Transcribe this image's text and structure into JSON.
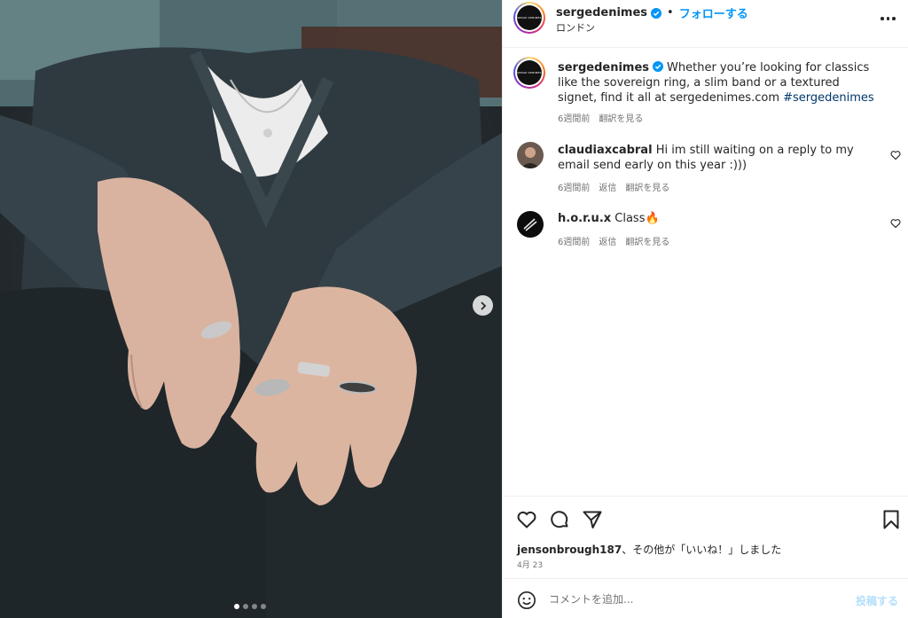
{
  "post": {
    "username": "sergedenimes",
    "follow_label": "フォローする",
    "separator": "•",
    "location": "ロンドン",
    "avatar_text": "SERGE DENIMES"
  },
  "caption": {
    "username": "sergedenimes",
    "text_before_tag": "Whether you’re looking for classics like the sovereign ring, a slim band or a textured signet, find it all at sergedenimes.com ",
    "hashtag": "#sergedenimes",
    "time": "6週間前",
    "translate": "翻訳を見る"
  },
  "comments": [
    {
      "username": "claudiaxcabral",
      "text": "Hi im still waiting on a reply to my email send early on this year :)))",
      "time": "6週間前",
      "reply": "返信",
      "translate": "翻訳を見る"
    },
    {
      "username": "h.o.r.u.x",
      "text": "Class🔥",
      "time": "6週間前",
      "reply": "返信",
      "translate": "翻訳を見る"
    }
  ],
  "likes": {
    "user": "jensonbrough187",
    "suffix": "、その他が「いいね！」しました"
  },
  "date": "4月 23",
  "composer": {
    "placeholder": "コメントを追加...",
    "post_label": "投稿する"
  },
  "carousel": {
    "total": 4,
    "active": 1
  },
  "colors": {
    "link": "#0095f6",
    "hashtag": "#00376b",
    "secondary": "#737373",
    "verified": "#0095f6"
  },
  "icons": [
    "verified-icon",
    "more-icon",
    "heart-icon",
    "comment-icon",
    "share-icon",
    "bookmark-icon",
    "emoji-icon",
    "chevron-right-icon"
  ]
}
